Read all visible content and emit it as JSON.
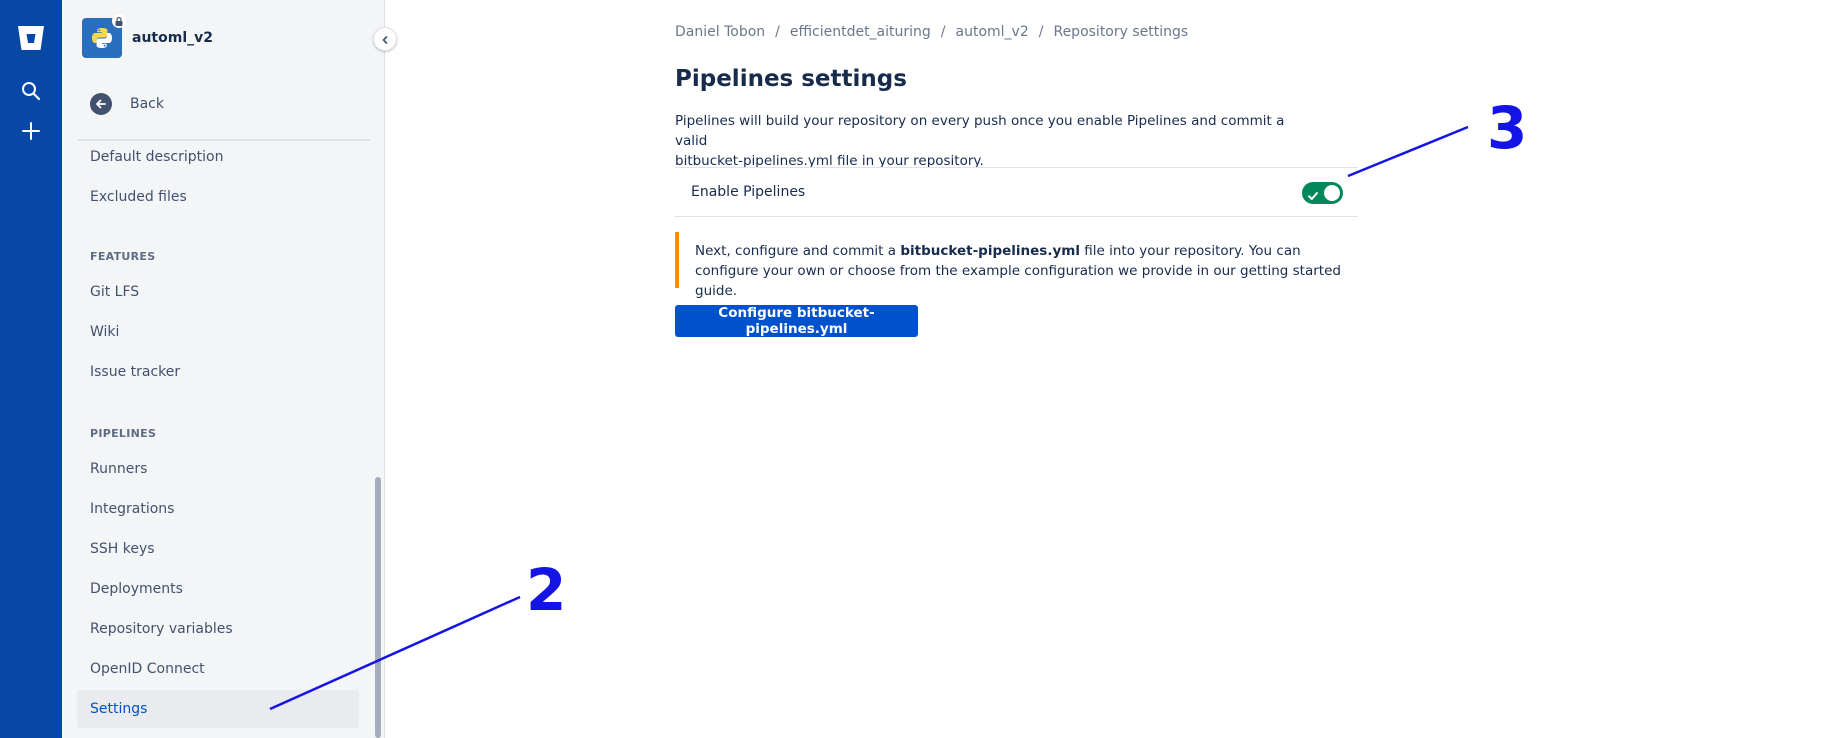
{
  "global_nav": {
    "icons": [
      "bitbucket-logo-icon",
      "search-icon",
      "plus-icon"
    ],
    "colors": {
      "background": "#0747a6"
    }
  },
  "sidebar": {
    "repo_name": "automl_v2",
    "back_label": "Back",
    "items_top": [
      {
        "label": "Default description"
      },
      {
        "label": "Excluded files"
      }
    ],
    "features_heading": "FEATURES",
    "features": [
      {
        "label": "Git LFS"
      },
      {
        "label": "Wiki"
      },
      {
        "label": "Issue tracker"
      }
    ],
    "pipelines_heading": "PIPELINES",
    "pipelines": [
      {
        "label": "Runners"
      },
      {
        "label": "Integrations"
      },
      {
        "label": "SSH keys"
      },
      {
        "label": "Deployments"
      },
      {
        "label": "Repository variables"
      },
      {
        "label": "OpenID Connect"
      },
      {
        "label": "Settings",
        "active": true
      }
    ]
  },
  "breadcrumb": [
    "Daniel Tobon",
    "efficientdet_aituring",
    "automl_v2",
    "Repository settings"
  ],
  "main": {
    "title": "Pipelines settings",
    "intro_line1": "Pipelines will build your repository on every push once you enable Pipelines and commit a valid",
    "intro_line2": "bitbucket-pipelines.yml file in your repository.",
    "enable_label": "Enable Pipelines",
    "enable_state": true,
    "note_prefix": "Next, configure and commit a ",
    "note_bold": "bitbucket-pipelines.yml",
    "note_suffix": " file into your repository. You can configure your own or choose from the example configuration we provide in our getting started guide.",
    "cta_label": "Configure bitbucket-pipelines.yml"
  },
  "annotations": [
    {
      "label": "2"
    },
    {
      "label": "3"
    }
  ],
  "colors": {
    "primary": "#0052cc",
    "toggle_on": "#00875a",
    "warning_border": "#ff8b00",
    "annotation": "#1414e6"
  }
}
